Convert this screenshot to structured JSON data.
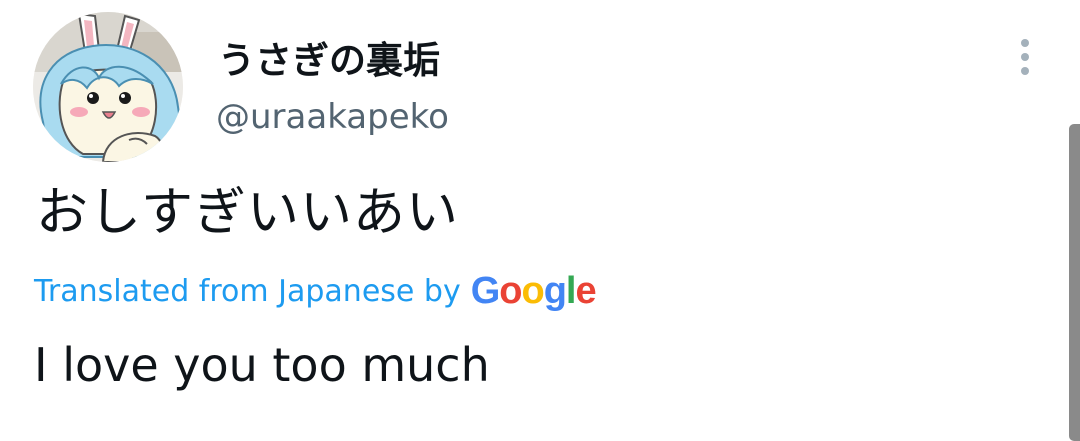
{
  "tweet": {
    "display_name": "うさぎの裏垢",
    "handle": "@uraakapeko",
    "text": "おしすぎいいあい",
    "translation_label": "Translated from Japanese by",
    "translation_provider": "Google",
    "translated_text": "I love you too much"
  },
  "icons": {
    "more": "more-vertical-icon",
    "avatar": "avatar-image"
  },
  "colors": {
    "text_primary": "#0f1419",
    "text_secondary": "#536471",
    "link": "#1d9bf0",
    "google_blue": "#4285F4",
    "google_red": "#EA4335",
    "google_yellow": "#FBBC05",
    "google_green": "#34A853"
  }
}
